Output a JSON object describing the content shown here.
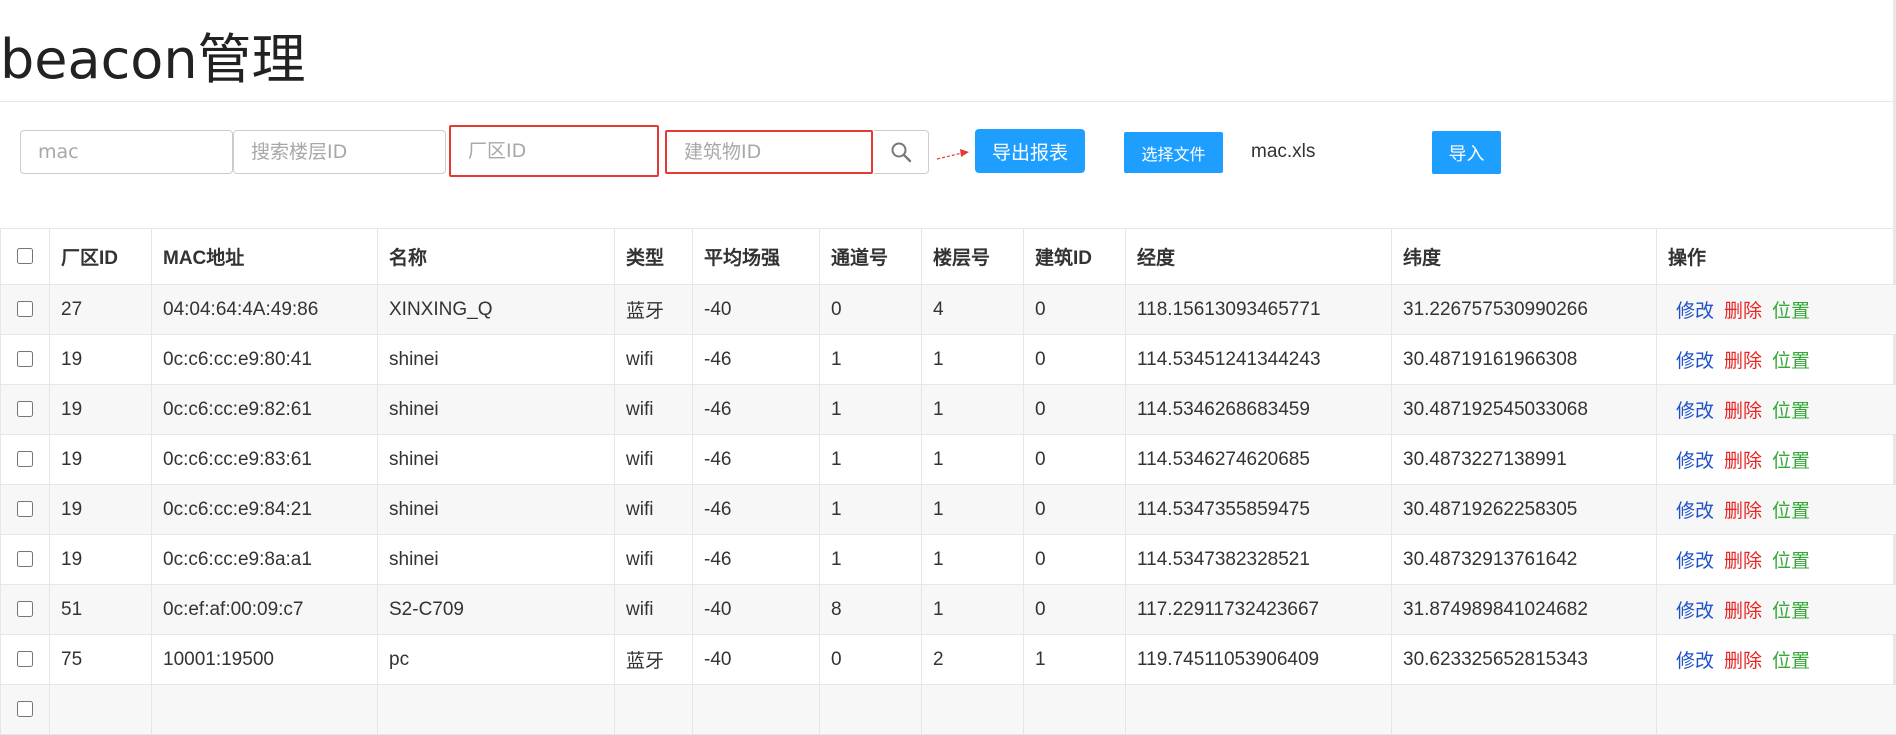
{
  "page": {
    "title": "beacon管理"
  },
  "filters": {
    "mac_placeholder": "mac",
    "floor_placeholder": "搜索楼层ID",
    "factory_placeholder": "厂区ID",
    "building_placeholder": "建筑物ID"
  },
  "icons": {
    "search": "search-icon",
    "arrow": "red-arrow-icon"
  },
  "toolbar": {
    "export_label": "导出报表",
    "choose_file_label": "选择文件",
    "file_name": "mac.xls",
    "import_label": "导入"
  },
  "colors": {
    "accent": "#1e9fff",
    "highlight_border": "#e53935",
    "edit": "#1e50c8",
    "delete": "#e82626",
    "locate": "#35a938"
  },
  "table": {
    "headers": [
      "厂区ID",
      "MAC地址",
      "名称",
      "类型",
      "平均场强",
      "通道号",
      "楼层号",
      "建筑ID",
      "经度",
      "纬度",
      "操作"
    ],
    "actions": {
      "edit": "修改",
      "delete": "删除",
      "locate": "位置"
    },
    "rows": [
      [
        "27",
        "04:04:64:4A:49:86",
        "XINXING_Q",
        "蓝牙",
        "-40",
        "0",
        "4",
        "0",
        "118.15613093465771",
        "31.226757530990266"
      ],
      [
        "19",
        "0c:c6:cc:e9:80:41",
        "shinei",
        "wifi",
        "-46",
        "1",
        "1",
        "0",
        "114.53451241344243",
        "30.48719161966308"
      ],
      [
        "19",
        "0c:c6:cc:e9:82:61",
        "shinei",
        "wifi",
        "-46",
        "1",
        "1",
        "0",
        "114.5346268683459",
        "30.487192545033068"
      ],
      [
        "19",
        "0c:c6:cc:e9:83:61",
        "shinei",
        "wifi",
        "-46",
        "1",
        "1",
        "0",
        "114.5346274620685",
        "30.4873227138991"
      ],
      [
        "19",
        "0c:c6:cc:e9:84:21",
        "shinei",
        "wifi",
        "-46",
        "1",
        "1",
        "0",
        "114.5347355859475",
        "30.48719262258305"
      ],
      [
        "19",
        "0c:c6:cc:e9:8a:a1",
        "shinei",
        "wifi",
        "-46",
        "1",
        "1",
        "0",
        "114.5347382328521",
        "30.48732913761642"
      ],
      [
        "51",
        "0c:ef:af:00:09:c7",
        "S2-C709",
        "wifi",
        "-40",
        "8",
        "1",
        "0",
        "117.22911732423667",
        "31.874989841024682"
      ],
      [
        "75",
        "10001:19500",
        "pc",
        "蓝牙",
        "-40",
        "0",
        "2",
        "1",
        "119.74511053906409",
        "30.623325652815343"
      ],
      [
        "",
        "",
        "",
        "",
        "",
        "",
        "",
        "",
        "",
        ""
      ]
    ]
  }
}
